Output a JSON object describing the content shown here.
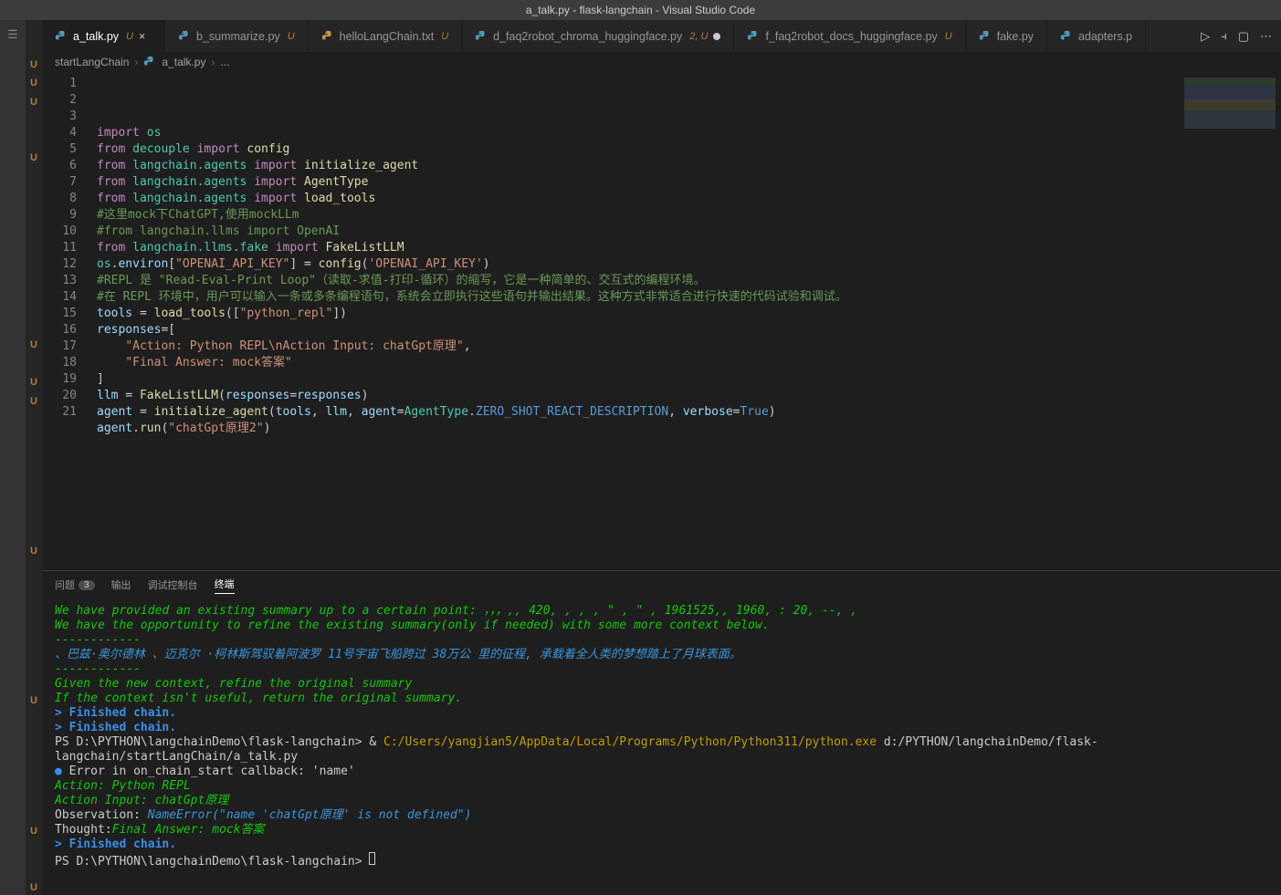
{
  "title": "a_talk.py - flask-langchain - Visual Studio Code",
  "tabs": [
    {
      "label": "a_talk.py",
      "status": "U",
      "active": true,
      "close": true
    },
    {
      "label": "b_summarize.py",
      "status": "U"
    },
    {
      "label": "helloLangChain.txt",
      "status": "U"
    },
    {
      "label": "d_faq2robot_chroma_huggingface.py",
      "status": "2, U",
      "modified": true
    },
    {
      "label": "f_faq2robot_docs_huggingface.py",
      "status": "U"
    },
    {
      "label": "fake.py"
    },
    {
      "label": "adapters.p"
    }
  ],
  "breadcrumb": {
    "root": "startLangChain",
    "file": "a_talk.py",
    "more": "..."
  },
  "gutter_marks": [
    "",
    "U",
    "U",
    "U",
    "",
    "",
    "U",
    "",
    "",
    "",
    "",
    "",
    "",
    "",
    "",
    "",
    "U",
    "",
    "U",
    "U",
    "",
    "",
    "",
    "",
    "",
    "",
    "",
    "U",
    "",
    "",
    "",
    "",
    "",
    "",
    "",
    "U",
    "",
    "",
    "",
    "",
    "",
    "",
    "U",
    "",
    "",
    "U"
  ],
  "code": {
    "lines": [
      {
        "n": 1,
        "html": "<span class='kw'>import</span> <span class='mod'>os</span>"
      },
      {
        "n": 2,
        "html": "<span class='kw'>from</span> <span class='mod'>decouple</span> <span class='kw'>import</span> <span class='fn'>config</span>"
      },
      {
        "n": 3,
        "html": "<span class='kw'>from</span> <span class='mod'>langchain.agents</span> <span class='kw'>import</span> <span class='fn'>initialize_agent</span>"
      },
      {
        "n": 4,
        "html": "<span class='kw'>from</span> <span class='mod'>langchain.agents</span> <span class='kw'>import</span> <span class='fn'>AgentType</span>"
      },
      {
        "n": 5,
        "html": "<span class='kw'>from</span> <span class='mod'>langchain.agents</span> <span class='kw'>import</span> <span class='fn'>load_tools</span>"
      },
      {
        "n": 6,
        "html": "<span class='cmt'>#这里mock下ChatGPT,使用mockLLm</span>"
      },
      {
        "n": 7,
        "html": "<span class='cmt'>#from langchain.llms import OpenAI</span>"
      },
      {
        "n": 8,
        "html": "<span class='kw'>from</span> <span class='mod'>langchain.llms.fake</span> <span class='kw'>import</span> <span class='fn'>FakeListLLM</span>"
      },
      {
        "n": 9,
        "html": ""
      },
      {
        "n": 10,
        "html": "<span class='mod'>os</span>.<span class='var'>environ</span>[<span class='str'>\"OPENAI_API_KEY\"</span>] <span class='op'>=</span> <span class='fn'>config</span>(<span class='str'>'OPENAI_API_KEY'</span>)"
      },
      {
        "n": 11,
        "html": ""
      },
      {
        "n": 12,
        "html": "<span class='cmt'>#REPL 是 \"Read-Eval-Print Loop\"（读取-求值-打印-循环）的缩写，它是一种简单的、交互式的编程环境。</span>"
      },
      {
        "n": 13,
        "html": "<span class='cmt'>#在 REPL 环境中，用户可以输入一条或多条编程语句，系统会立即执行这些语句并输出结果。这种方式非常适合进行快速的代码试验和调试。</span>"
      },
      {
        "n": 14,
        "html": "<span class='var'>tools</span> <span class='op'>=</span> <span class='fn'>load_tools</span>([<span class='str'>\"python_repl\"</span>])"
      },
      {
        "n": 15,
        "html": "<span class='var'>responses</span><span class='op'>=</span>["
      },
      {
        "n": 16,
        "html": "    <span class='str'>\"Action: Python REPL\\nAction Input: chatGpt原理\"</span>,"
      },
      {
        "n": 17,
        "html": "    <span class='str'>\"Final Answer: mock答案\"</span>"
      },
      {
        "n": 18,
        "html": "]"
      },
      {
        "n": 19,
        "html": "<span class='var'>llm</span> <span class='op'>=</span> <span class='fn'>FakeListLLM</span>(<span class='var'>responses</span><span class='op'>=</span><span class='var'>responses</span>)"
      },
      {
        "n": 20,
        "html": "<span class='var'>agent</span> <span class='op'>=</span> <span class='fn'>initialize_agent</span>(<span class='var'>tools</span>, <span class='var'>llm</span>, <span class='var'>agent</span><span class='op'>=</span><span class='mod'>AgentType</span>.<span class='const'>ZERO_SHOT_REACT_DESCRIPTION</span>, <span class='var'>verbose</span><span class='op'>=</span><span class='const'>True</span>)"
      },
      {
        "n": 21,
        "html": "<span class='var'>agent</span>.<span class='fn'>run</span>(<span class='str'>\"chatGpt原理2\"</span>)"
      }
    ]
  },
  "panel": {
    "tabs": [
      {
        "label": "问题",
        "badge": "3"
      },
      {
        "label": "输出"
      },
      {
        "label": "调试控制台"
      },
      {
        "label": "终端",
        "active": true
      }
    ],
    "terminal": [
      {
        "cls": "g",
        "text": "We have provided an existing summary up to a certain point: ，，，,,  420, , , , \" , \" , 1961525,,  1960, :  20, --,  ,"
      },
      {
        "cls": "g",
        "text": "We have the opportunity to refine the existing summary(only if needed) with some more context below."
      },
      {
        "cls": "g",
        "text": "------------"
      },
      {
        "cls": "c",
        "text": "、巴兹·奥尔德林 、迈克尔 ·柯林斯驾驭着阿波罗 11号宇宙飞船跨过 38万公  里的征程, 承载着全人类的梦想踏上了月球表面。"
      },
      {
        "cls": "g",
        "text": "------------"
      },
      {
        "cls": "g",
        "text": "Given the new context, refine the original summary"
      },
      {
        "cls": "g",
        "text": "If the context isn't useful, return the original summary."
      },
      {
        "cls": "",
        "text": ""
      },
      {
        "cls": "b",
        "bold": true,
        "text": "> Finished chain."
      },
      {
        "cls": "",
        "text": ""
      },
      {
        "cls": "b",
        "bold": true,
        "text": "> Finished chain."
      },
      {
        "cls": "mix",
        "parts": [
          {
            "cls": "",
            "text": "PS D:\\PYTHON\\langchainDemo\\flask-langchain> & "
          },
          {
            "cls": "y",
            "text": "C:/Users/yangjian5/AppData/Local/Programs/Python/Python311/python.exe"
          },
          {
            "cls": "",
            "text": " d:/PYTHON/langchainDemo/flask-langchain/startLangChain/a_talk.py"
          }
        ]
      },
      {
        "cls": "mix",
        "parts": [
          {
            "cls": "b",
            "text": "● "
          },
          {
            "cls": "",
            "text": "Error in on_chain_start callback: 'name'"
          }
        ]
      },
      {
        "cls": "g",
        "text": "Action: Python REPL"
      },
      {
        "cls": "g",
        "text": "Action Input: chatGpt原理"
      },
      {
        "cls": "mix",
        "parts": [
          {
            "cls": "",
            "text": "Observation: "
          },
          {
            "cls": "c",
            "text": "NameError(\"name 'chatGpt原理' is not defined\")"
          }
        ]
      },
      {
        "cls": "mix",
        "parts": [
          {
            "cls": "",
            "text": "Thought:"
          },
          {
            "cls": "g",
            "text": "Final Answer: mock答案"
          }
        ]
      },
      {
        "cls": "",
        "text": ""
      },
      {
        "cls": "b",
        "bold": true,
        "text": "> Finished chain."
      },
      {
        "cls": "prompt",
        "text": "PS D:\\PYTHON\\langchainDemo\\flask-langchain> ",
        "cursor": true
      }
    ]
  }
}
